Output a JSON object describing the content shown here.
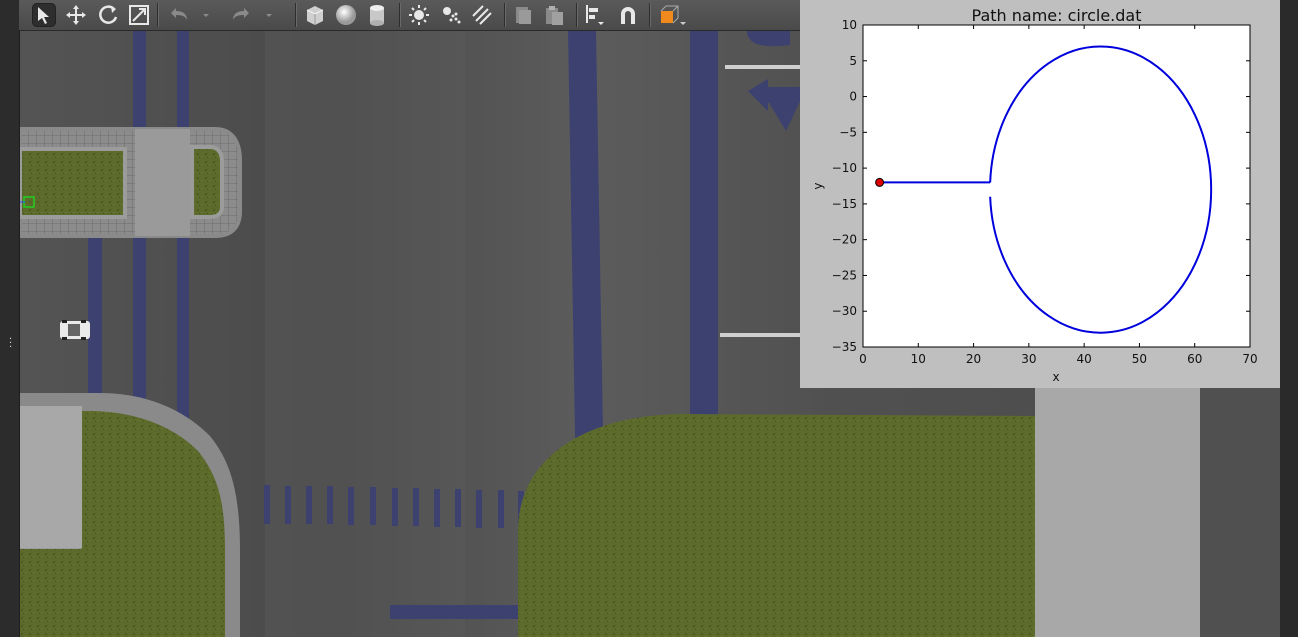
{
  "toolbar": {
    "tools": [
      "select-tool-icon",
      "translate-tool-icon",
      "rotate-tool-icon",
      "scale-tool-icon",
      "undo-icon",
      "undo-dropdown-icon",
      "redo-icon",
      "redo-dropdown-icon",
      "box-shape-icon",
      "sphere-shape-icon",
      "cylinder-shape-icon",
      "point-light-icon",
      "spot-light-icon",
      "directional-light-icon",
      "copy-icon",
      "paste-icon",
      "align-icon",
      "snap-magnet-icon",
      "view-angle-icon"
    ]
  },
  "plot": {
    "title": "Path name: circle.dat"
  },
  "chart_data": {
    "type": "line",
    "title": "Path name: circle.dat",
    "xlabel": "x",
    "ylabel": "y",
    "xlim": [
      0,
      70
    ],
    "ylim": [
      -35,
      10
    ],
    "xticks": [
      "0",
      "10",
      "20",
      "30",
      "40",
      "50",
      "60",
      "70"
    ],
    "yticks": [
      "10",
      "5",
      "0",
      "−5",
      "−10",
      "−15",
      "−20",
      "−25",
      "−30",
      "−35"
    ],
    "grid": false,
    "series": [
      {
        "color": "#0000dd",
        "segments": [
          {
            "kind": "line",
            "x": [
              3,
              23
            ],
            "y": [
              -12,
              -12
            ]
          },
          {
            "kind": "ellipse_arc",
            "cx": 43,
            "cy": -12,
            "rx": 20,
            "ry": 20,
            "y_top": 8,
            "y_bottom": -32,
            "x_left": 23,
            "x_right": 63,
            "gap_between_y": [
              -12,
              -14
            ]
          }
        ]
      }
    ],
    "markers": [
      {
        "x": 3,
        "y": -12,
        "color": "#dd0000"
      }
    ]
  }
}
